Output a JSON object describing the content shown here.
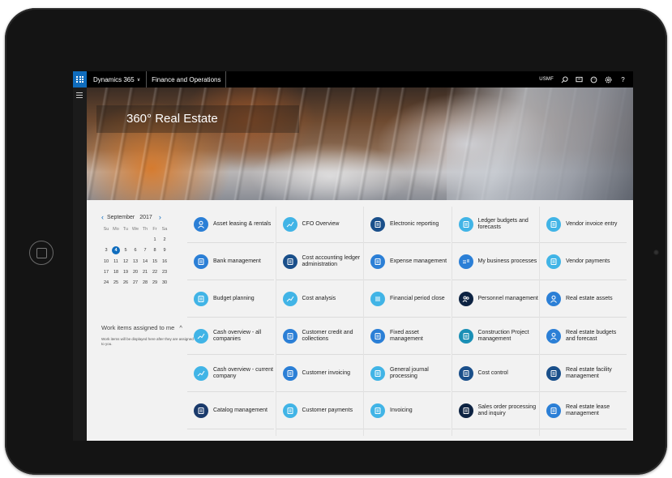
{
  "topbar": {
    "app_name": "Dynamics 365",
    "app_chevron": "∨",
    "module": "Finance and Operations",
    "company": "USMF"
  },
  "hero": {
    "title": "360° Real Estate"
  },
  "calendar": {
    "month": "September",
    "year": "2017",
    "prev": "‹",
    "next": "›",
    "weekdays": [
      "Su",
      "Mo",
      "Tu",
      "We",
      "Th",
      "Fr",
      "Sa"
    ],
    "weeks": [
      [
        "",
        "",
        "",
        "",
        "",
        "1",
        "2"
      ],
      [
        "3",
        "4",
        "5",
        "6",
        "7",
        "8",
        "9"
      ],
      [
        "10",
        "11",
        "12",
        "13",
        "14",
        "15",
        "16"
      ],
      [
        "17",
        "18",
        "19",
        "20",
        "21",
        "22",
        "23"
      ],
      [
        "24",
        "25",
        "26",
        "27",
        "28",
        "29",
        "30"
      ]
    ],
    "selected_day": "4"
  },
  "work_items": {
    "title": "Work items assigned to me",
    "toggle": "^",
    "text": "Work items will be displayed here after they are assigned to you."
  },
  "colors": {
    "accent": "#0f6cbd",
    "teal": "#2aa3d8",
    "sky": "#41b4e6",
    "navy": "#1a3a6b",
    "dark": "#0d2342"
  },
  "tiles": [
    [
      {
        "label": "Asset leasing & rentals",
        "icon": "person-icon",
        "color": "#2b7fd6"
      },
      {
        "label": "Bank management",
        "icon": "bank-icon",
        "color": "#2b7fd6"
      },
      {
        "label": "Budget planning",
        "icon": "budget-icon",
        "color": "#41b4e6"
      },
      {
        "label": "Cash overview - all companies",
        "icon": "trend-icon",
        "color": "#41b4e6"
      },
      {
        "label": "Cash overview - current company",
        "icon": "trend-icon",
        "color": "#41b4e6"
      },
      {
        "label": "Catalog management",
        "icon": "catalog-icon",
        "color": "#1a3a6b"
      }
    ],
    [
      {
        "label": "CFO Overview",
        "icon": "trend-icon",
        "color": "#41b4e6"
      },
      {
        "label": "Cost accounting ledger administration",
        "icon": "ledger-icon",
        "color": "#1a4f8a"
      },
      {
        "label": "Cost analysis",
        "icon": "trend-icon",
        "color": "#41b4e6"
      },
      {
        "label": "Customer credit and collections",
        "icon": "collections-icon",
        "color": "#2b7fd6"
      },
      {
        "label": "Customer invoicing",
        "icon": "invoice-icon",
        "color": "#2b7fd6"
      },
      {
        "label": "Customer payments",
        "icon": "payment-icon",
        "color": "#41b4e6"
      }
    ],
    [
      {
        "label": "Electronic reporting",
        "icon": "report-icon",
        "color": "#1a4f8a"
      },
      {
        "label": "Expense management",
        "icon": "expense-icon",
        "color": "#2b7fd6"
      },
      {
        "label": "Financial period close",
        "icon": "list-icon",
        "color": "#41b4e6"
      },
      {
        "label": "Fixed asset management",
        "icon": "asset-icon",
        "color": "#2b7fd6"
      },
      {
        "label": "General journal processing",
        "icon": "journal-icon",
        "color": "#41b4e6"
      },
      {
        "label": "Invoicing",
        "icon": "invoice-icon",
        "color": "#41b4e6"
      }
    ],
    [
      {
        "label": "Ledger budgets and forecasts",
        "icon": "budget-icon",
        "color": "#41b4e6"
      },
      {
        "label": "My business processes",
        "icon": "process-icon",
        "color": "#2b7fd6"
      },
      {
        "label": "Personnel management",
        "icon": "people-icon",
        "color": "#0d2342"
      },
      {
        "label": "Construction Project management",
        "icon": "project-icon",
        "color": "#1a8fb5"
      },
      {
        "label": "Cost control",
        "icon": "cost-icon",
        "color": "#1a4f8a"
      },
      {
        "label": "Sales order processing and inquiry",
        "icon": "order-icon",
        "color": "#0d2342"
      }
    ],
    [
      {
        "label": "Vendor invoice entry",
        "icon": "invoice-icon",
        "color": "#41b4e6"
      },
      {
        "label": "Vendor payments",
        "icon": "payment-icon",
        "color": "#41b4e6"
      },
      {
        "label": "Real estate assets",
        "icon": "person-icon",
        "color": "#2b7fd6"
      },
      {
        "label": "Real estate budgets and forecast",
        "icon": "person-icon",
        "color": "#2b7fd6"
      },
      {
        "label": "Real estate facility management",
        "icon": "facility-icon",
        "color": "#1a4f8a"
      },
      {
        "label": "Real estate lease management",
        "icon": "lease-icon",
        "color": "#2b7fd6"
      }
    ]
  ]
}
